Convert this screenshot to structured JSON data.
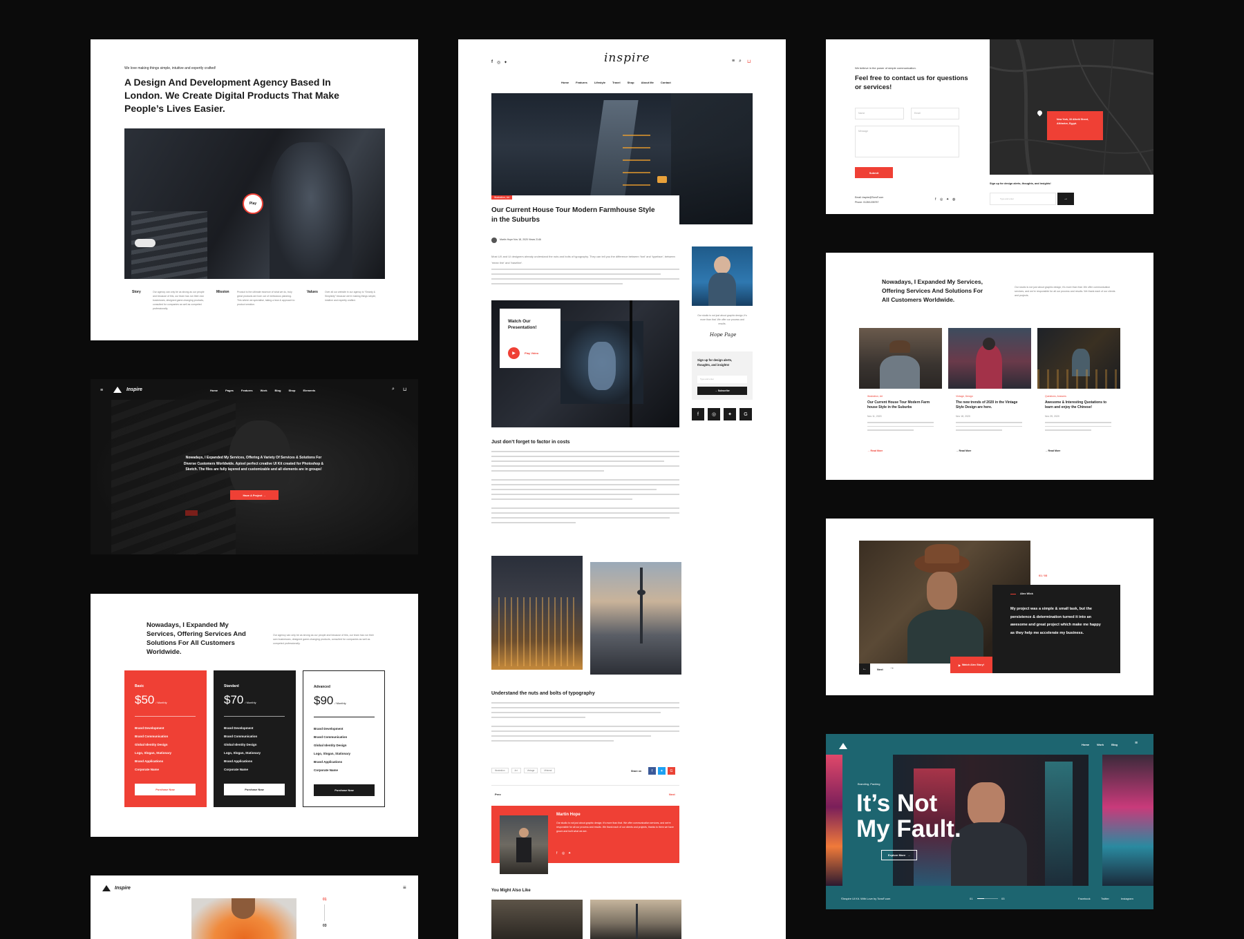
{
  "colors": {
    "background": "#0b0b0b",
    "accent": "#ef4035",
    "dark": "#1b1b1b",
    "teal": "#1d6570"
  },
  "about": {
    "kicker": "We love making things simple, intuitive and expertly crafted!",
    "heading": "A Design And Development Agency Based In London. We Create Digital Products That Make People’s Lives Easier.",
    "play": "Play",
    "columns": [
      {
        "title": "Story",
        "text": "Our agency can only be as strong as our people and because of this, our team has run their own businesses, designed game-changing products, consulted for companies as well as competed professionally."
      },
      {
        "title": "Mission",
        "text": "Product is the ultimate essence of what we do, truly great products are born out of meticulous planning. This where we specialise, taking a lean & approach to product creation."
      },
      {
        "title": "Values",
        "text": "Over all our website in our agency is “Smarty & Simplicity” because we’re making things simple, intuitive and expertly crafted."
      }
    ]
  },
  "hero": {
    "brand": "Inspire",
    "nav": [
      "Home",
      "Pages",
      "Features",
      "Work",
      "Blog",
      "Shop",
      "Elements"
    ],
    "text": "Nowadays, I Expanded My Services, Offering A Variety Of Services & Solutions For Diverse Customers Worldwide. Apixel perfect creative UI Kit created for Photoshop & Sketch. The files are fully layered and customizable and all elements are in groups!",
    "button": "Have A Project →"
  },
  "pricing": {
    "heading": "Nowadays, I Expanded My Services, Offering Services And Solutions For All Customers Worldwide.",
    "desc": "Our agency can only be as strong as our people and because of this, our team has run their own businesses, designed game-changing products, consulted for companies as well as competed professionally.",
    "plans": [
      {
        "name": "Basic",
        "price": "$50",
        "per": "/ Monthly",
        "button": "Purchase Now"
      },
      {
        "name": "Standard",
        "price": "$70",
        "per": "/ Monthly",
        "button": "Purchase Now"
      },
      {
        "name": "Advanced",
        "price": "$90",
        "per": "/ Monthly",
        "button": "Purchase Now"
      }
    ],
    "features": [
      "Brand Development",
      "Brand Communication",
      "Global Identity Design",
      "Logo, Slogan, Stationary",
      "Brand Applications",
      "Corporate Name"
    ]
  },
  "mini": {
    "brand": "Inspire",
    "counter_top": "01",
    "counter_bottom": "03"
  },
  "blog": {
    "logo": "inspire",
    "nav": [
      "Home",
      "Features",
      "Lifestyle",
      "Travel",
      "Shop",
      "About Me",
      "Contact"
    ],
    "tag": "Illustration, Art",
    "title": "Our Current House Tour Modern Farmhouse Style in the Suburbs",
    "meta": "Martin Hope    Nov 18, 2020    Views 2146",
    "intro": "Most UX and UI designers already understand the nuts and bolts of typography. They can tell you the difference between 'font' and 'typeface', between 'mean line' and 'baseline'.",
    "video_title": "Watch Our Presentation!",
    "video_button": "Play Video",
    "section1": "Just don’t forget to factor in costs",
    "section2": "Understand the nuts and bolts of typography",
    "sidebar_text": "Our studio is not just about graphic design; it’s more than that. We offer our process and results.",
    "signature": "Hope Page",
    "newsletter_title": "Sign up for design alerts, thoughts, and insights!",
    "newsletter_placeholder": "Type and enter",
    "subscribe": "→ Subscribe",
    "tags": [
      "Illustration",
      "Art",
      "Vintage",
      "Minimal"
    ],
    "share": "Share on",
    "prev": "Prev",
    "next": "Next",
    "author": {
      "name": "Martin Hope",
      "bio": "Our studio is not just about graphic design; it’s more than that. We offer communication services, and we’re responsible for all our process and results. We thank each of our clients and projects, thanks to them we have grown and built what we are."
    },
    "related": "You Might Also Like"
  },
  "contact": {
    "kicker": "We believe in the power of simple communication.",
    "heading": "Feel free to contact us for questions or services!",
    "name_placeholder": "Name",
    "email_placeholder": "Email",
    "message_placeholder": "Message",
    "submit": "Submit",
    "email": "Email: inspire@TonsF.com",
    "phone": "Phone: 0128/1205757",
    "map_label": "New York, 33 Albehl Street, Alkharize, Egypt.",
    "signup": "Sign up for design alerts, thoughts, and insights!",
    "signup_placeholder": "Type and enter"
  },
  "posts": {
    "heading": "Nowadays, I Expanded My Services, Offering Services And Solutions For All Customers Worldwide.",
    "desc": "Our studio is not just about graphic design; it’s more than that. We offer communication services, and we’re responsible for all our process and results. We thank each of our clients and projects.",
    "items": [
      {
        "tag": "Illustration, Art",
        "title": "Our Current House Tour Modern Farm house Style in the Suburbs",
        "date": "Nov 11, 2020",
        "more": "→ Read More"
      },
      {
        "tag": "Vintage, Design",
        "title": "The new trends of 2020 in the Vintage Style Design are here.",
        "date": "Nov 18, 2020",
        "more": "→ Read More"
      },
      {
        "tag": "Questions, Answers",
        "title": "Awesome & Interesting Quotations to learn and enjoy the Chinese!",
        "date": "Nov 25, 2020",
        "more": "→ Read More"
      }
    ]
  },
  "testimonial": {
    "counter": "01 / 03",
    "name": "Alex Wick",
    "quote": "My project was a simple & small task, but the persistence & determination turned it into an awesome and great project which make me happy as they help me accelerate my business.",
    "watch": "Watch Alex Story!",
    "next": "Next"
  },
  "fault": {
    "nav": [
      "Home",
      "Work",
      "Blog"
    ],
    "tag": "Branding, Packing",
    "title_line1": "It’s Not",
    "title_line2": "My Fault.",
    "button": "Explore More",
    "footer": "©Inspire UI Kit. With Love by TonsF.com",
    "pager_start": "01",
    "pager_end": "03",
    "social": [
      "Facebook",
      "Twitter",
      "Instagram"
    ]
  }
}
